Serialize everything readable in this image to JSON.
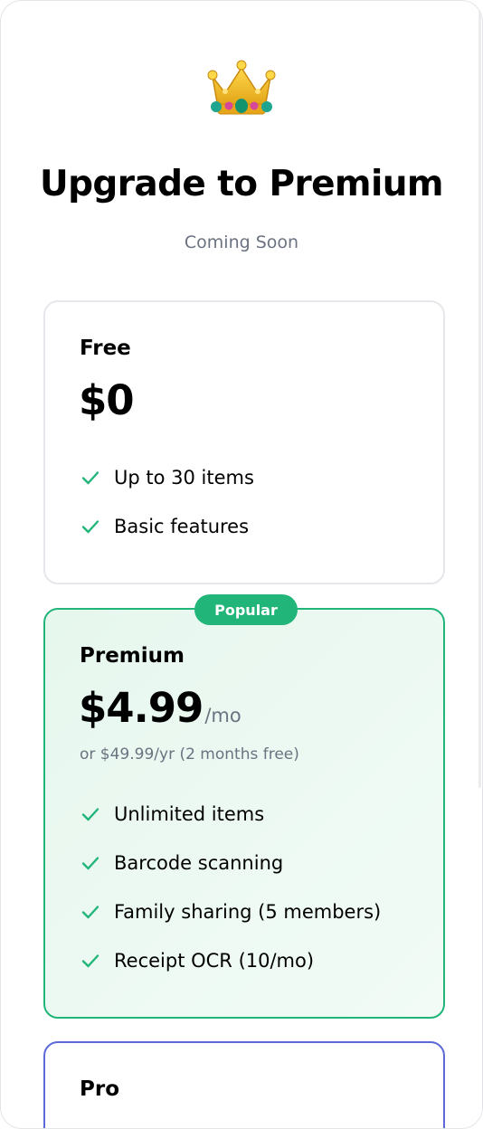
{
  "header": {
    "icon": "crown-icon",
    "title": "Upgrade to Premium",
    "subtitle": "Coming Soon"
  },
  "plans": [
    {
      "name": "Free",
      "price": "$0",
      "period": "",
      "note": "",
      "features": [
        "Up to 30 items",
        "Basic features"
      ]
    },
    {
      "name": "Premium",
      "badge": "Popular",
      "price": "$4.99",
      "period": "/mo",
      "note": "or $49.99/yr (2 months free)",
      "features": [
        "Unlimited items",
        "Barcode scanning",
        "Family sharing (5 members)",
        "Receipt OCR (10/mo)"
      ]
    },
    {
      "name": "Pro"
    }
  ],
  "colors": {
    "accent": "#22b57a",
    "pro_border": "#5b6ad6",
    "muted_text": "#6b7280",
    "card_border": "#e5e7eb"
  }
}
